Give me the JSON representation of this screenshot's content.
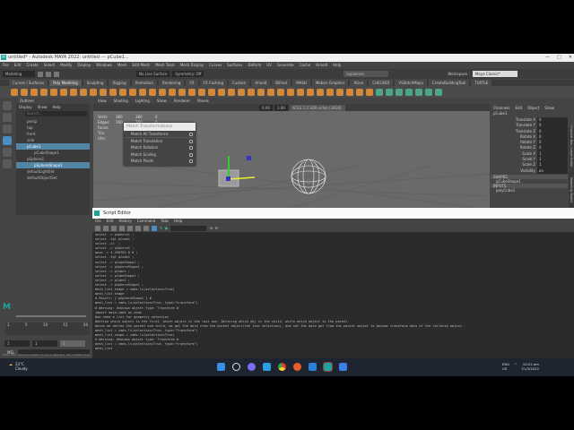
{
  "window": {
    "title": "untitled* - Autodesk MAYA 2022: untitled    ---    pCube1...",
    "app_icon": "M",
    "minimize": "—",
    "maximize": "□",
    "close": "✕"
  },
  "menubar": [
    "File",
    "Edit",
    "Create",
    "Select",
    "Modify",
    "Display",
    "Windows",
    "Mesh",
    "Edit Mesh",
    "Mesh Tools",
    "Mesh Display",
    "Curves",
    "Surfaces",
    "Deform",
    "UV",
    "Generate",
    "Cache",
    "Arnold",
    "Help"
  ],
  "status": {
    "mode": "Modeling",
    "live_surface": "No Live Surface",
    "symmetry": "Symmetry: Off",
    "user": "kaplamen",
    "workspace_label": "Workspace :",
    "workspace": "Maya Classic*"
  },
  "shelf_tabs": [
    "Curves / Surfaces",
    "Poly Modeling",
    "Sculpting",
    "Rigging",
    "Animation",
    "Rendering",
    "FX",
    "FX Caching",
    "Custom",
    "Arnold",
    "Bifrost",
    "MASH",
    "Motion Graphics",
    "XGen",
    "CHECKER",
    "VSStitchMaya",
    "CreateBuildingTool",
    "TURTLE"
  ],
  "shelf_active": 1,
  "outliner": {
    "title": "Outliner",
    "menu": [
      "Display",
      "Show",
      "Help"
    ],
    "search_placeholder": "Search...",
    "items": [
      {
        "label": "persp",
        "selected": false,
        "indent": 1
      },
      {
        "label": "top",
        "selected": false,
        "indent": 1
      },
      {
        "label": "front",
        "selected": false,
        "indent": 1
      },
      {
        "label": "side",
        "selected": false,
        "indent": 1
      },
      {
        "label": "pCube1",
        "selected": true,
        "indent": 1
      },
      {
        "label": "pCubeShape1",
        "selected": false,
        "indent": 2
      },
      {
        "label": "pSphere1",
        "selected": false,
        "indent": 1
      },
      {
        "label": "pSphereShape1",
        "selected": true,
        "indent": 2
      },
      {
        "label": "defaultLightSet",
        "selected": false,
        "indent": 1
      },
      {
        "label": "defaultObjectSet",
        "selected": false,
        "indent": 1
      }
    ]
  },
  "viewport": {
    "menu": [
      "View",
      "Shading",
      "Lighting",
      "Show",
      "Renderer",
      "Panels"
    ],
    "exposure": "0.00",
    "gamma": "1.00",
    "colorspace": "ACES 1.0 SDR-video (sRGB)",
    "hud": [
      [
        "Verts:",
        "380",
        "380",
        "0"
      ],
      [
        "Edges:",
        "760",
        "760",
        "0"
      ],
      [
        "Faces:",
        "",
        "",
        ""
      ],
      [
        "Tris:",
        "",
        "",
        ""
      ],
      [
        "UVs:",
        "",
        "",
        ""
      ]
    ]
  },
  "match_menu": {
    "title": "Match Transformations",
    "items": [
      "Match All Transforms",
      "Match Translation",
      "Match Rotation",
      "Match Scaling",
      "Match Pivots"
    ]
  },
  "channel_box": {
    "menu": [
      "Channels",
      "Edit",
      "Object",
      "Show"
    ],
    "object": "pCube1",
    "attrs": [
      [
        "Translate X",
        "0"
      ],
      [
        "Translate Y",
        "0"
      ],
      [
        "Translate Z",
        "0"
      ],
      [
        "Rotate X",
        "0"
      ],
      [
        "Rotate Y",
        "0"
      ],
      [
        "Rotate Z",
        "0"
      ],
      [
        "Scale X",
        "1"
      ],
      [
        "Scale Y",
        "1"
      ],
      [
        "Scale Z",
        "1"
      ],
      [
        "Visibility",
        "on"
      ]
    ],
    "shapes_label": "SHAPES",
    "shape": "pCubeShape1",
    "inputs_label": "INPUTS",
    "input": "polyCube1",
    "side_tabs": [
      "Channel Box / Layer Editor",
      "Modeling Toolkit"
    ]
  },
  "script_editor": {
    "title": "Script Editor",
    "menu": [
      "File",
      "Edit",
      "History",
      "Command",
      "Tabs",
      "Help"
    ],
    "lines": [
      "select -r pSphere1 ;",
      "select -tgl pCube1 ;",
      "select -cl  ;",
      "select -r pSphere1 ;",
      "move -r 4.458702 0 0 ;",
      "select -tgl pCube1 ;",
      "select -r pCubeShape1 ;",
      "select -r pSphereShape1 ;",
      "select -r pCube1 ;",
      "select -r pCubeShape1 ;",
      "select -r pCube1 ;",
      "select -r pSphereShape1 ;",
      "mesh_list_shape = cmds.ls(selection=True)",
      "mesh_list_shape",
      "# Result: ['pSphereShape1'] #",
      "mesh_list = cmds.ls(selection=True, type=\"transform\")",
      "# Warning: Unknown object type: Transform #",
      "import maya.cmds as cmds",
      "",
      "#we need a list for geometry selection",
      "#define which object is the first, which object is the last one. Defining which obj is the child, while which object is the parent.",
      "#once we define the parent and child, we get the data from the parent object(the last selection), and set the data got from the parent object to become transform data of the children object.",
      "",
      "mesh_list = cmds.ls(selection=True, type=\"Transform\")",
      "mesh_list_shape = cmds.ls(selection=True)",
      "# Warning: Unknown object type: Transform #",
      "mesh_list = cmds.ls(selection=True, type=\"transform\")",
      "mesh_list"
    ]
  },
  "timeline": {
    "ticks": [
      "1",
      "5",
      "10",
      "15",
      "20"
    ],
    "start": "1",
    "end": "1",
    "current": "1"
  },
  "cmdline": {
    "label": "MEL",
    "help": "Move Tool: Use manipulator to move object(s). Ctrl+middle-drag ..."
  },
  "taskbar": {
    "temp": "23°C",
    "weather": "Cloudy",
    "lang1": "ENG",
    "lang2": "US",
    "time": "10:22 am",
    "date": "21/3/2022"
  }
}
